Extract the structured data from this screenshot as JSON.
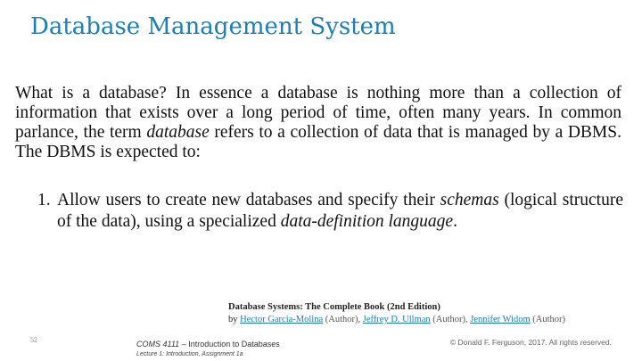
{
  "slide": {
    "title": "Database Management System",
    "intro": {
      "part1": "What is a database? In essence a database is nothing more than a collection of information that exists over a long period of time, often many years. In common parlance, the term ",
      "emph": "database",
      "part2": " refers to a collection of data that is managed by a DBMS. The DBMS is expected to:"
    },
    "list": [
      {
        "number": "1.",
        "text_a": "Allow users to create new databases and specify their ",
        "emph_a": "schemas",
        "text_b": " (logical structure of the data), using a specialized ",
        "emph_b": "data-definition language",
        "text_c": "."
      }
    ]
  },
  "reference": {
    "title": "Database Systems: The Complete Book (2nd Edition)",
    "by": "by ",
    "authors": [
      {
        "name": "Hector Garcia-Molina",
        "role": " (Author), "
      },
      {
        "name": "Jeffrey D. Ullman",
        "role": " (Author), "
      },
      {
        "name": "Jennifer Widom",
        "role": " (Author)"
      }
    ]
  },
  "footer": {
    "page_number": "52",
    "course_code": "COMS 4111",
    "course_sep": " – ",
    "course_title": "Introduction to Databases",
    "lecture": "Lecture 1: Introduction, Assignment 1a",
    "copyright": "© Donald F. Ferguson, 2017. All rights reserved."
  }
}
